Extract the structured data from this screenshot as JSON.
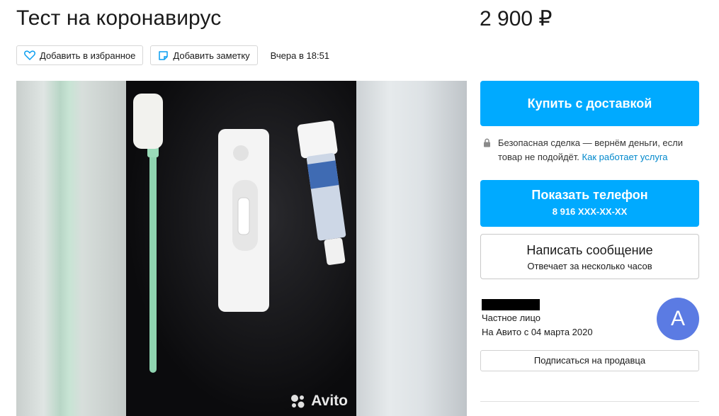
{
  "listing": {
    "title": "Тест на коронавирус",
    "price": "2 900 ₽"
  },
  "actions": {
    "favorite_label": "Добавить в избранное",
    "note_label": "Добавить заметку",
    "posted": "Вчера в 18:51"
  },
  "gallery": {
    "watermark": "Avito"
  },
  "sidebar": {
    "buy_label": "Купить с доставкой",
    "safe_deal_text": "Безопасная сделка — вернём деньги, если товар не подойдёт.",
    "safe_deal_link": "Как работает услуга",
    "phone_label": "Показать телефон",
    "phone_number": "8 916 XXX-XX-XX",
    "message_label": "Написать сообщение",
    "message_sub": "Отвечает за несколько часов",
    "seller_type": "Частное лицо",
    "seller_since": "На Авито с 04 марта 2020",
    "avatar_letter": "А",
    "subscribe_label": "Подписаться на продавца"
  },
  "colors": {
    "accent": "#00aaff",
    "link": "#0088cc",
    "avatar": "#5b7be3"
  },
  "icons": [
    "heart-icon",
    "note-icon",
    "lock-icon",
    "avito-logo-icon"
  ]
}
